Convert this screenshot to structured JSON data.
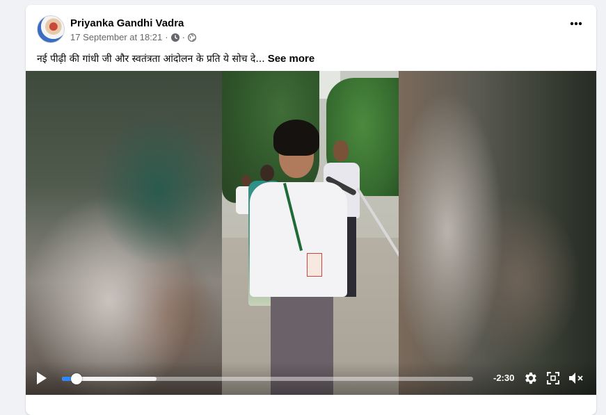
{
  "post": {
    "author": "Priyanka Gandhi Vadra",
    "timestamp": "17 September at 18:21",
    "separator": "·",
    "privacy_icon": "globe-icon",
    "caption": "नई पीढ़ी की गांधी जी और स्वतंत्रता आंदोलन के प्रति ये सोच दे...",
    "see_more_label": "See more",
    "more_options_icon": "more-horizontal-icon"
  },
  "video": {
    "time_remaining": "-2:30",
    "progress_fraction": 0.035,
    "buffered_fraction": 0.23,
    "accent_color": "#2d88ff",
    "icons": [
      "play-icon",
      "settings-gear-icon",
      "fullscreen-icon",
      "volume-muted-icon"
    ]
  }
}
